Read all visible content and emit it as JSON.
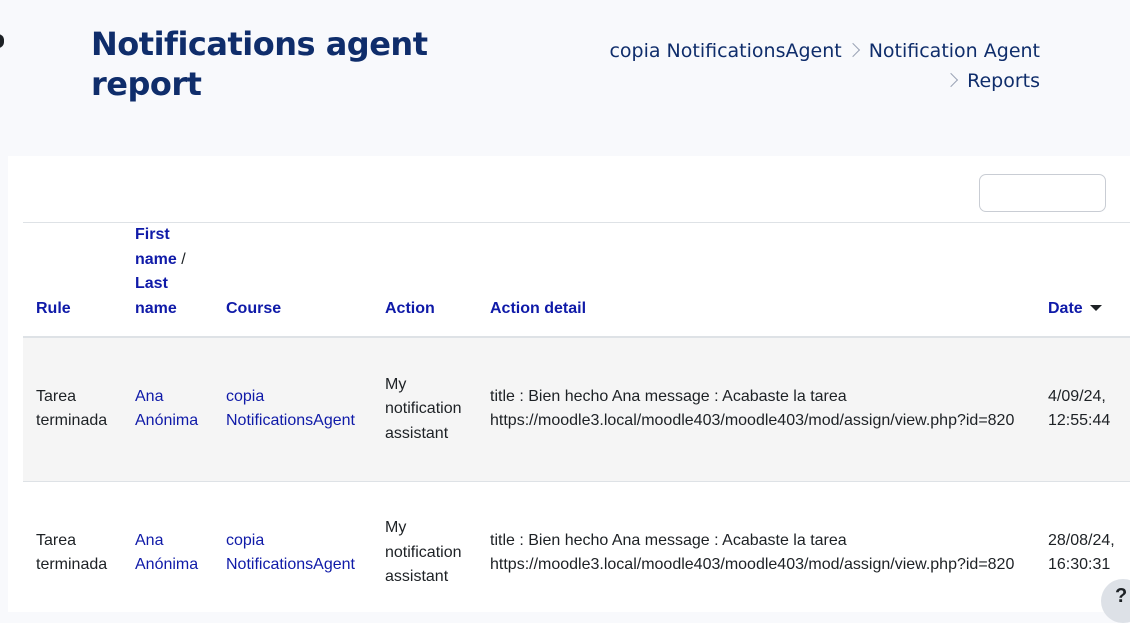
{
  "page": {
    "title": "Notifications agent report"
  },
  "breadcrumb": [
    {
      "label": "copia NotificationsAgent"
    },
    {
      "label": "Notification Agent"
    },
    {
      "label": "Reports"
    }
  ],
  "table": {
    "headers": {
      "rule": "Rule",
      "first_name": "First name",
      "slash": " / ",
      "last_name": "Last name",
      "course": "Course",
      "action": "Action",
      "action_detail": "Action detail",
      "date": "Date"
    },
    "rows": [
      {
        "rule": "Tarea terminada",
        "name": "Ana Anónima",
        "course": "copia NotificationsAgent",
        "action": "My notification assistant",
        "detail": "title : Bien hecho Ana message : Acabaste la tarea https://moodle3.local/moodle403/moodle403/mod/assign/view.php?id=820",
        "date": "4/09/24, 12:55:44"
      },
      {
        "rule": "Tarea terminada",
        "name": "Ana Anónima",
        "course": "copia NotificationsAgent",
        "action": "My notification assistant",
        "detail": "title : Bien hecho Ana message : Acabaste la tarea https://moodle3.local/moodle403/moodle403/mod/assign/view.php?id=820",
        "date": "28/08/24, 16:30:31"
      }
    ]
  },
  "help": {
    "label": "?"
  }
}
